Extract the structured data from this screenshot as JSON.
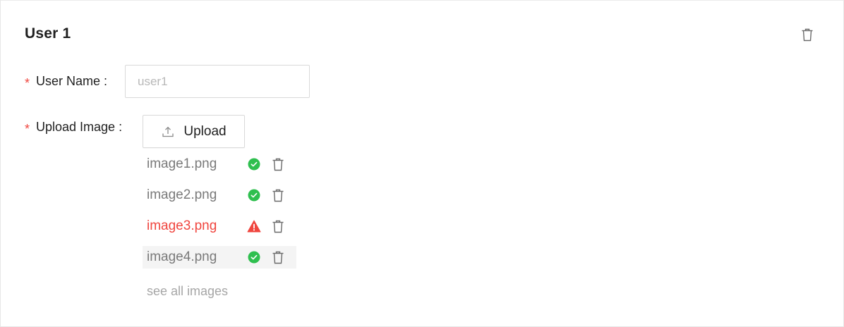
{
  "card": {
    "title": "User 1"
  },
  "fields": {
    "username": {
      "label": "User Name",
      "colon": ":",
      "placeholder": "user1",
      "value": ""
    },
    "upload": {
      "label": "Upload Image",
      "colon": ":",
      "button_label": "Upload"
    }
  },
  "required_mark": "*",
  "files": [
    {
      "name": "image1.png",
      "status": "success",
      "status_icon": "check-circle-icon"
    },
    {
      "name": "image2.png",
      "status": "success",
      "status_icon": "check-circle-icon"
    },
    {
      "name": "image3.png",
      "status": "error",
      "status_icon": "warning-triangle-icon"
    },
    {
      "name": "image4.png",
      "status": "success",
      "status_icon": "check-circle-icon"
    }
  ],
  "see_all_label": "see all images",
  "colors": {
    "required": "#f0463f",
    "success": "#2fbf4f",
    "error": "#f0463f",
    "muted_text": "#7a7a7a",
    "link_text": "#a6a6a6"
  }
}
